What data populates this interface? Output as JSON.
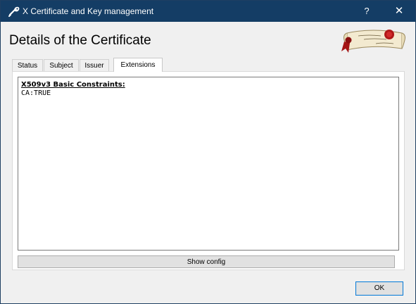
{
  "window": {
    "title": "X Certificate and Key management",
    "help_label": "?",
    "close_label": "✕",
    "icon": "certificate-key-icon",
    "titlebar_color": "#143d65"
  },
  "dialog": {
    "heading": "Details of the Certificate",
    "logo": "xca-scroll-logo"
  },
  "tabs": [
    {
      "label": "Status",
      "active": false
    },
    {
      "label": "Subject",
      "active": false
    },
    {
      "label": "Issuer",
      "active": false
    },
    {
      "label": "Extensions",
      "active": true
    }
  ],
  "extensions": {
    "title": "X509v3 Basic Constraints:",
    "value": "CA:TRUE"
  },
  "buttons": {
    "show_config": "Show config",
    "ok": "OK"
  }
}
